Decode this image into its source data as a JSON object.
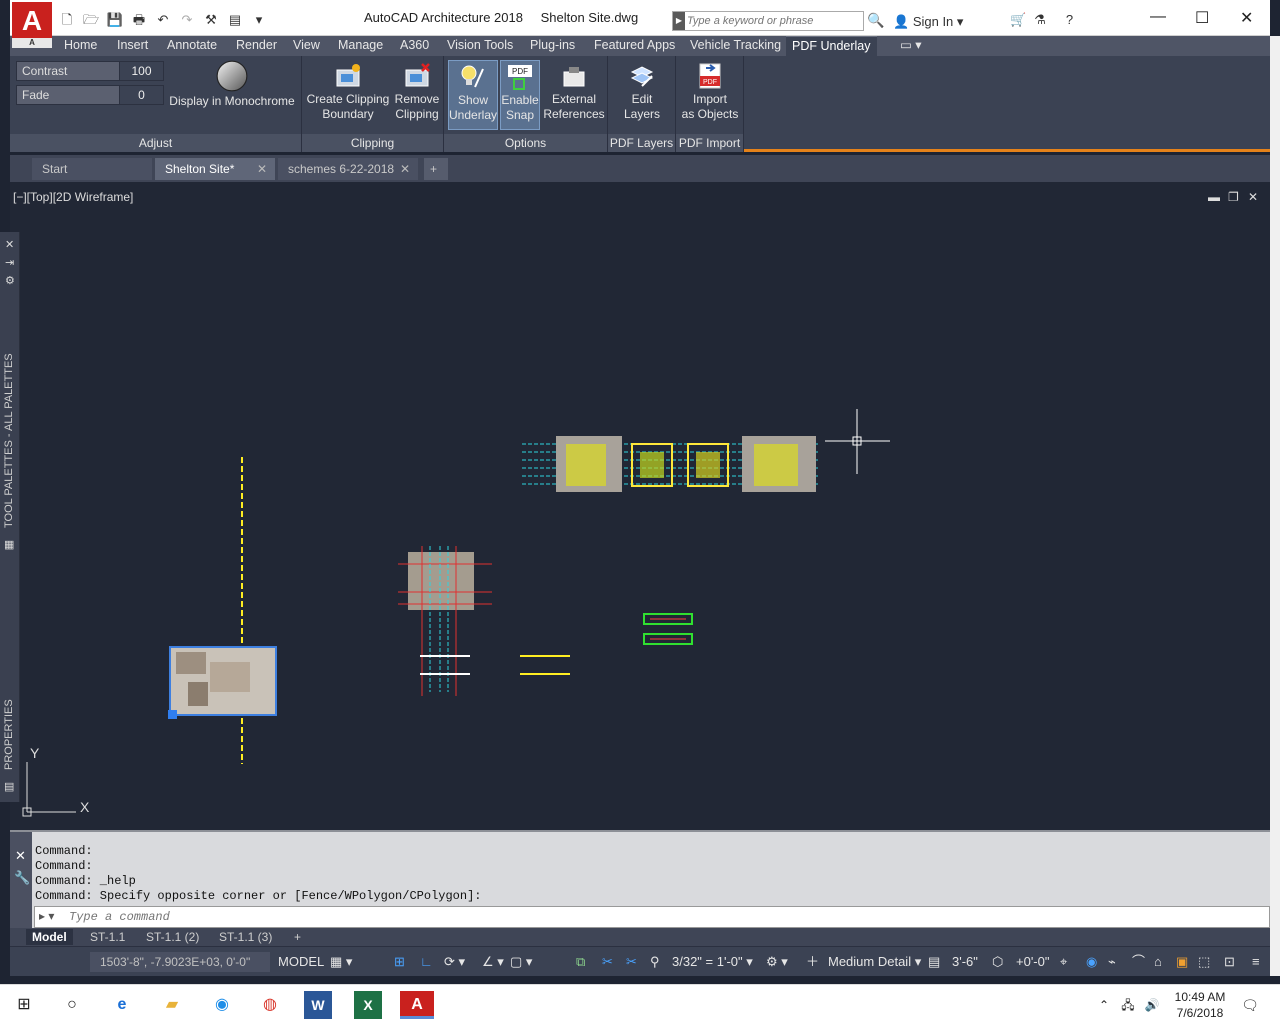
{
  "window": {
    "app_name": "AutoCAD Architecture 2018",
    "file_name": "Shelton Site.dwg",
    "search_placeholder": "Type a keyword or phrase",
    "sign_in": "Sign In",
    "logo_letter": "A",
    "logo_sub": "A"
  },
  "ribbon_tabs": [
    "Home",
    "Insert",
    "Annotate",
    "Render",
    "View",
    "Manage",
    "A360",
    "Vision Tools",
    "Plug-ins",
    "Featured Apps",
    "Vehicle Tracking",
    "PDF Underlay"
  ],
  "ribbon": {
    "adjust": {
      "contrast_label": "Contrast",
      "contrast_value": "100",
      "fade_label": "Fade",
      "fade_value": "0",
      "monochrome": "Display in Monochrome",
      "panel_label": "Adjust"
    },
    "clipping": {
      "create_line1": "Create Clipping",
      "create_line2": "Boundary",
      "remove_line1": "Remove",
      "remove_line2": "Clipping",
      "panel_label": "Clipping"
    },
    "options": {
      "show_line1": "Show",
      "show_line2": "Underlay",
      "snap_line1": "Enable",
      "snap_line2": "Snap",
      "xref_line1": "External",
      "xref_line2": "References",
      "pdf_icon": "PDF",
      "panel_label": "Options"
    },
    "pdf_layers": {
      "line1": "Edit",
      "line2": "Layers",
      "panel_label": "PDF Layers"
    },
    "pdf_import": {
      "line1": "Import",
      "line2": "as Objects",
      "pdf_icon": "PDF",
      "panel_label": "PDF Import"
    }
  },
  "doc_tabs": [
    "Start",
    "Shelton Site*",
    "schemes 6-22-2018"
  ],
  "viewport": {
    "label": "[−][Top][2D Wireframe]",
    "ucs_x": "X",
    "ucs_y": "Y"
  },
  "palettes": {
    "tool_palettes": "TOOL PALETTES - ALL PALETTES",
    "properties": "PROPERTIES"
  },
  "command": {
    "lines": [
      "Command:",
      "Command:",
      "Command: _help",
      "Command: Specify opposite corner or [Fence/WPolygon/CPolygon]:"
    ],
    "placeholder": "Type a command"
  },
  "layout_tabs": [
    "Model",
    "ST-1.1",
    "ST-1.1 (2)",
    "ST-1.1 (3)"
  ],
  "status": {
    "coords": "1503'-8\", -7.9023E+03, 0'-0\"",
    "model": "MODEL",
    "scale": "3/32\" = 1'-0\"",
    "detail": "Medium Detail",
    "cut_plane": "3'-6\"",
    "elevation": "+0'-0\""
  },
  "taskbar": {
    "time": "10:49 AM",
    "date": "7/6/2018"
  },
  "colors": {
    "ribbon_bg": "#3b4253",
    "viewport_bg": "#212735",
    "accent_orange": "#e5821a",
    "autocad_red": "#c9211e"
  }
}
